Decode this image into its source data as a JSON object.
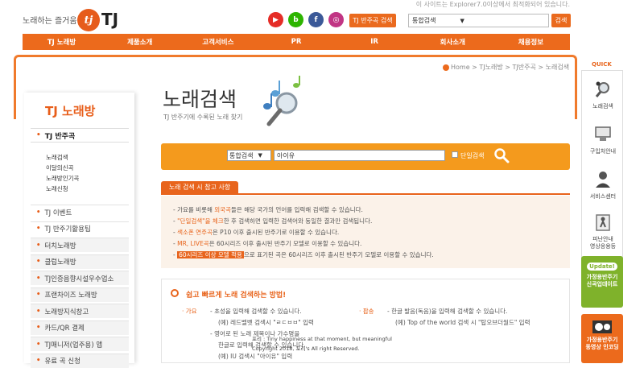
{
  "header": {
    "top_note": "이 사이트는 Explorer7.0이상에서 최적화되어 있습니다.",
    "slogan": "노래하는 즐거움",
    "logo_mark": "tj",
    "logo_text": "TJ",
    "social": [
      {
        "name": "youtube",
        "glyph": "▶",
        "color": "#e52d27"
      },
      {
        "name": "blog",
        "glyph": "b",
        "color": "#2db400"
      },
      {
        "name": "facebook",
        "glyph": "f",
        "color": "#3b5998"
      },
      {
        "name": "instagram",
        "glyph": "◎",
        "color": "#c13584"
      }
    ],
    "tj_search_button": "TJ 반주곡 검색",
    "search_select": "통합검색",
    "search_button": "검색"
  },
  "nav": [
    "TJ 노래방",
    "제품소개",
    "고객서비스",
    "PR",
    "IR",
    "회사소개",
    "채용정보"
  ],
  "breadcrumb": {
    "home": "Home",
    "sep": ">",
    "level1": "TJ노래방",
    "level2": "TJ반주곡",
    "current": "노래검색"
  },
  "sidebar": {
    "title": "TJ 노래방",
    "active": "TJ 반주곡",
    "subitems": [
      "노래검색",
      "이달의신곡",
      "노래방인기곡",
      "노래신청"
    ],
    "items": [
      {
        "label": "TJ 이벤트",
        "gray": false
      },
      {
        "label": "TJ 반주기활용팁",
        "gray": false
      },
      {
        "label": "터치노래방",
        "gray": true
      },
      {
        "label": "클럽노래방",
        "gray": true
      },
      {
        "label": "TJ인증음향시설우수업소",
        "gray": true
      },
      {
        "label": "프랜차이즈 노래방",
        "gray": true
      },
      {
        "label": "노래방지식창고",
        "gray": true
      },
      {
        "label": "카드/QR 결제",
        "gray": true
      },
      {
        "label": "TJ매니저(업주용) 앱",
        "gray": true
      },
      {
        "label": "유료 곡 신청",
        "gray": true
      }
    ]
  },
  "main": {
    "title": "노래검색",
    "subtitle": "TJ 반주기에 수록된 노래 찾기",
    "search": {
      "select": "통합검색",
      "value": "아이유",
      "checkbox_label": "단일검색"
    },
    "tips_tab": "노래 검색 시 참고 사항",
    "tips": [
      {
        "pre": "- 가요를 비롯해 ",
        "em": "외국곡",
        "post": "들은 해당 국가의 언어를 입력해 검색할 수 있습니다."
      },
      {
        "pre": "- ",
        "em": "\"단일검색\"을 체크",
        "post": "한 후 검색하면 입력한 검색어와 동일한 결과만 검색됩니다."
      },
      {
        "pre": "- ",
        "em": "색소폰 연주곡",
        "post": "은 P10 이후 출시된 반주기로 이용할 수 있습니다."
      },
      {
        "pre": "- ",
        "em": "MR, LIVE곡",
        "post": "은 60시리즈 이후 출시된 반주기 모델로 이용할 수 있습니다."
      },
      {
        "pre": "- ",
        "tag": "60시리즈 이상 모델 적용",
        "post": "으로 표기된 곡은 60시리즈 이후 출시된 반주기 모델로 이용할 수 있습니다."
      }
    ],
    "howto": {
      "title": "쉽고 빠르게 노래 검색하는 방법!",
      "kpop_label": "· 가요",
      "kpop_lines": [
        "- 초성을 입력해 검색할 수 있습니다.",
        "(예) 레드벨벳 검색시 \"ㄹㄷㅂㅂ\" 입력",
        "- 영어로 된 노래 제목이나 가수명을",
        "한글로 입력해 검색할 수 있습니다.",
        "(예) IU 검색시 \"아이유\" 입력"
      ],
      "pop_label": "· 팝송",
      "pop_lines": [
        "- 한글 발음(독음)을 입력해 검색할 수 있습니다.",
        "(예) Top of the world 검색 시 \"탑오브더월드\" 입력"
      ],
      "toast": [
        "포리 : Tiny happiness at that moment, but meaningful",
        "Copyright 2018, 포리's All right Reserved."
      ]
    }
  },
  "quick": {
    "title": "QUICK",
    "items": [
      "노래검색",
      "구입처안내",
      "서비스센터",
      "피난안내\n영상응용등"
    ],
    "update_label": "Update!",
    "update_text": "가정용반주기\n신곡업데이트",
    "video_text": "가정용반주기\n동영상 인코딩"
  },
  "colors": {
    "brand_orange": "#ec6a1c",
    "search_bar": "#f49a1d",
    "notes_bg": "#fbf2e9",
    "update_green": "#7fb22b"
  }
}
